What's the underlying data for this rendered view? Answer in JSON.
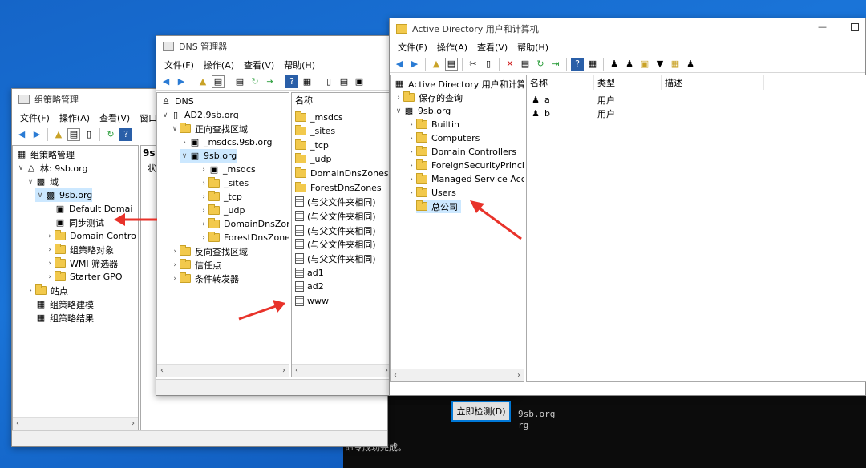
{
  "gpm": {
    "title": "组策略管理",
    "menu": [
      "文件(F)",
      "操作(A)",
      "查看(V)",
      "窗口"
    ],
    "tree": [
      {
        "label": "组策略管理"
      },
      {
        "label": "林: 9sb.org"
      },
      {
        "label": "域"
      },
      {
        "label": "9sb.org"
      },
      {
        "label": "Default Domai"
      },
      {
        "label": "同步测试"
      },
      {
        "label": "Domain Contro"
      },
      {
        "label": "组策略对象"
      },
      {
        "label": "WMI 筛选器"
      },
      {
        "label": "Starter GPO"
      },
      {
        "label": "站点"
      },
      {
        "label": "组策略建模"
      },
      {
        "label": "组策略结果"
      }
    ],
    "right_title": "9s",
    "right_tab": "状"
  },
  "dns": {
    "title": "DNS 管理器",
    "menu": [
      "文件(F)",
      "操作(A)",
      "查看(V)",
      "帮助(H)"
    ],
    "tree": [
      {
        "label": "DNS"
      },
      {
        "label": "AD2.9sb.org"
      },
      {
        "label": "正向查找区域"
      },
      {
        "label": "_msdcs.9sb.org"
      },
      {
        "label": "9sb.org"
      },
      {
        "label": "_msdcs"
      },
      {
        "label": "_sites"
      },
      {
        "label": "_tcp"
      },
      {
        "label": "_udp"
      },
      {
        "label": "DomainDnsZone"
      },
      {
        "label": "ForestDnsZones"
      },
      {
        "label": "反向查找区域"
      },
      {
        "label": "信任点"
      },
      {
        "label": "条件转发器"
      }
    ],
    "list_header": "名称",
    "list": [
      "_msdcs",
      "_sites",
      "_tcp",
      "_udp",
      "DomainDnsZones",
      "ForestDnsZones",
      "(与父文件夹相同)",
      "(与父文件夹相同)",
      "(与父文件夹相同)",
      "(与父文件夹相同)",
      "(与父文件夹相同)",
      "ad1",
      "ad2",
      "www"
    ]
  },
  "ad": {
    "title": "Active Directory 用户和计算机",
    "menu": [
      "文件(F)",
      "操作(A)",
      "查看(V)",
      "帮助(H)"
    ],
    "tree": [
      {
        "label": "Active Directory 用户和计算机"
      },
      {
        "label": "保存的查询"
      },
      {
        "label": "9sb.org"
      },
      {
        "label": "Builtin"
      },
      {
        "label": "Computers"
      },
      {
        "label": "Domain Controllers"
      },
      {
        "label": "ForeignSecurityPrincipa"
      },
      {
        "label": "Managed Service Acco"
      },
      {
        "label": "Users"
      },
      {
        "label": "总公司"
      }
    ],
    "columns": [
      "名称",
      "类型",
      "描述"
    ],
    "rows": [
      {
        "name": "a",
        "type": "用户"
      },
      {
        "name": "b",
        "type": "用户"
      }
    ]
  },
  "console": {
    "lines": [
      "9sb.org",
      "rg",
      "命令成功完成。"
    ]
  },
  "dialog": {
    "check_now_button": "立即检测(D)"
  },
  "colors": {
    "arrow": "#e8322a",
    "accent": "#0078d7",
    "selected": "#cce8ff"
  }
}
